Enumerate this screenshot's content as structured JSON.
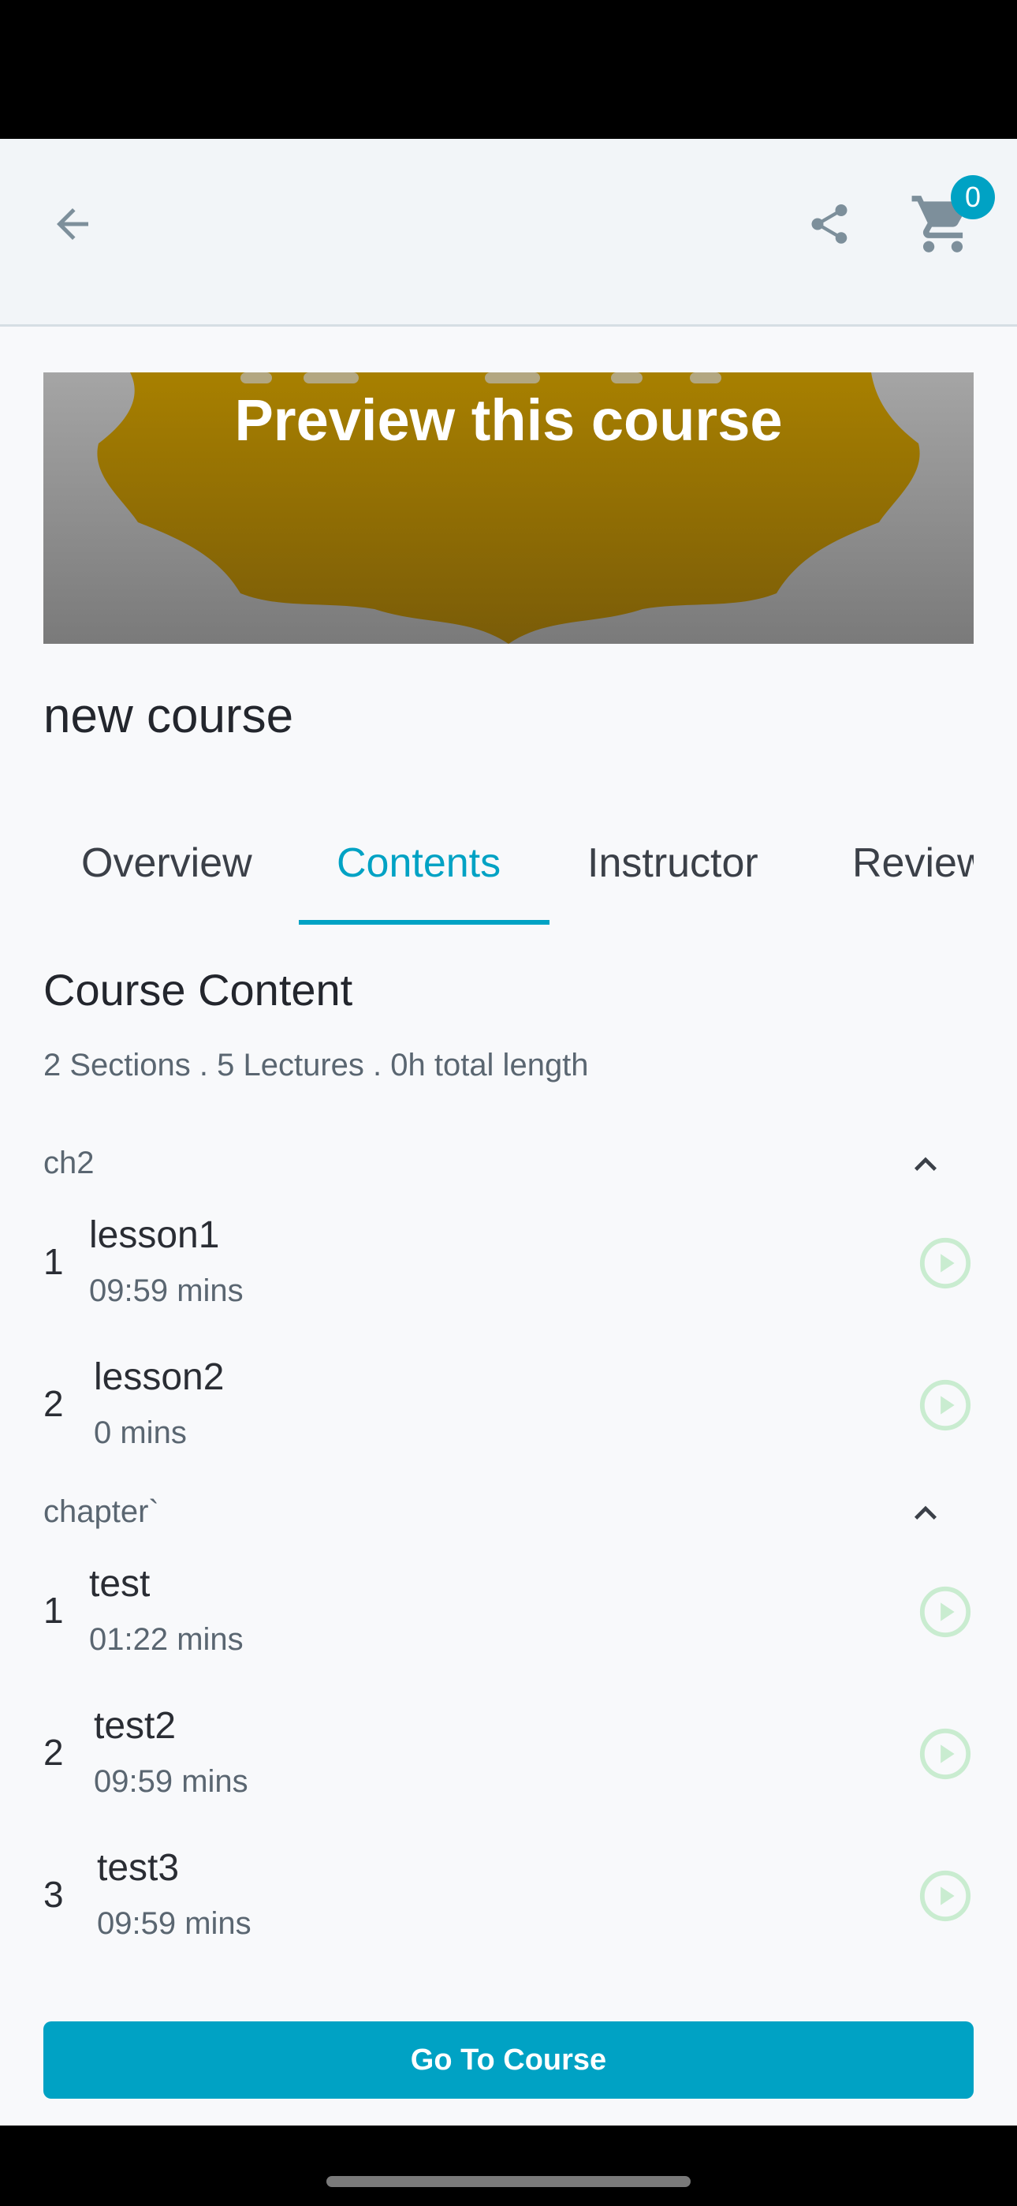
{
  "header": {
    "cart_count": "0",
    "icons": [
      "arrow-left-icon",
      "share-icon",
      "cart-icon"
    ]
  },
  "preview": {
    "label": "Preview this course"
  },
  "course": {
    "title": "new course"
  },
  "tabs": [
    {
      "label": "Overview"
    },
    {
      "label": "Contents"
    },
    {
      "label": "Instructor"
    },
    {
      "label": "Reviews"
    }
  ],
  "content": {
    "heading": "Course Content",
    "summary": "2 Sections . 5 Lectures . 0h total length",
    "sections": [
      {
        "title": "ch2",
        "lessons": [
          {
            "number": "1",
            "title": "lesson1",
            "duration": "09:59 mins"
          },
          {
            "number": "2",
            "title": "lesson2",
            "duration": "0 mins"
          }
        ]
      },
      {
        "title": "chapter`",
        "lessons": [
          {
            "number": "1",
            "title": "test",
            "duration": "01:22 mins"
          },
          {
            "number": "2",
            "title": "test2",
            "duration": "09:59 mins"
          },
          {
            "number": "3",
            "title": "test3",
            "duration": "09:59 mins"
          }
        ]
      }
    ]
  },
  "cta": {
    "label": "Go To Course"
  },
  "colors": {
    "accent": "#00a2c4",
    "play_icon": "#c9ecd0",
    "icon_gray": "#7d8f9b"
  }
}
